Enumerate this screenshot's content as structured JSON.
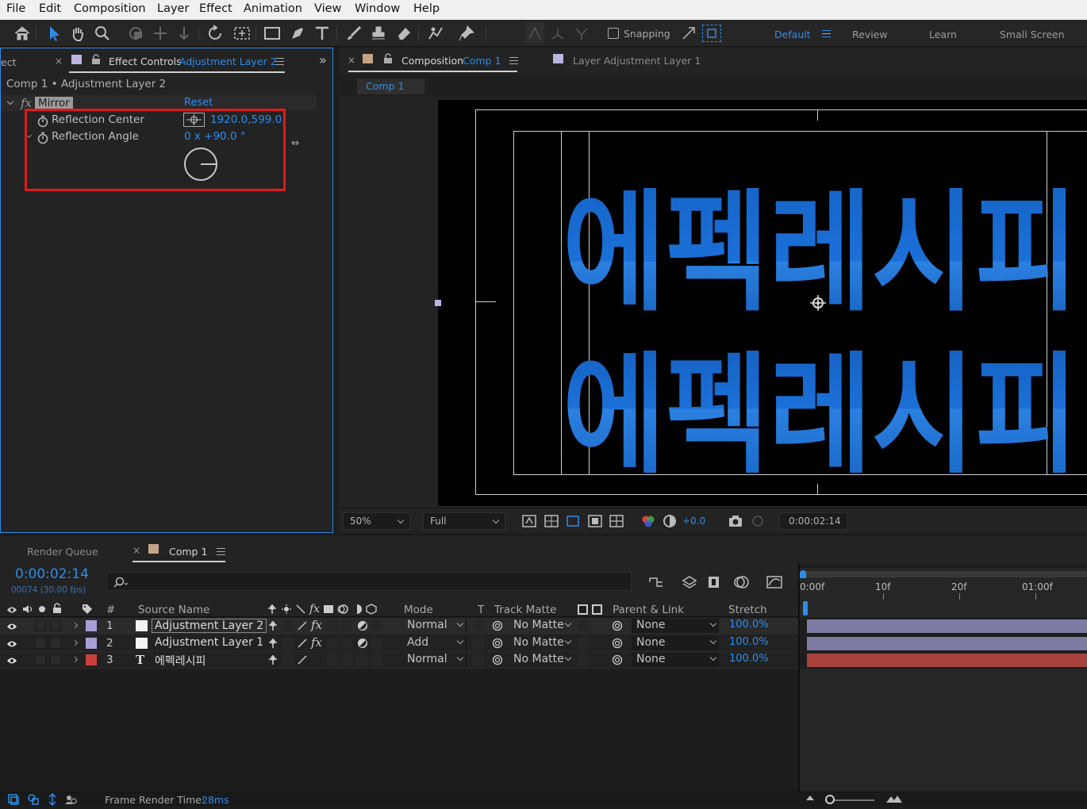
{
  "menu": [
    "File",
    "Edit",
    "Composition",
    "Layer",
    "Effect",
    "Animation",
    "View",
    "Window",
    "Help"
  ],
  "toolbar": {
    "tools": [
      "home-icon",
      "selection-tool-icon",
      "hand-tool-icon",
      "zoom-tool-icon",
      "orbit-camera-icon",
      "pan-camera-icon",
      "dolly-camera-icon",
      "rotate-tool-icon",
      "pan-behind-icon",
      "rectangle-tool-icon",
      "pen-tool-icon",
      "type-tool-icon",
      "brush-tool-icon",
      "clone-stamp-icon",
      "eraser-tool-icon",
      "roto-brush-icon",
      "puppet-pin-icon"
    ],
    "snapping_label": "Snapping",
    "workspaces": [
      "Default",
      "Review",
      "Learn",
      "Small Screen"
    ],
    "active_workspace": "Default"
  },
  "effect_controls": {
    "tab_prefix": "ect",
    "tab_title": "Effect Controls",
    "tab_layer": "Adjustment Layer 2",
    "breadcrumb": "Comp 1 • Adjustment Layer 2",
    "effect_fx": "fx",
    "effect_name": "Mirror",
    "reset_label": "Reset",
    "props": [
      {
        "name": "Reflection Center",
        "value": "1920.0,599.0"
      },
      {
        "name": "Reflection Angle",
        "value": "0 x +90.0 °"
      }
    ]
  },
  "composition": {
    "tab_title": "Composition",
    "tab_comp": "Comp 1",
    "layer_tab": "Layer Adjustment Layer 1",
    "flow_tab": "Comp 1",
    "viewer_text_top": "에펙레시피",
    "viewer_text_bottom": "에펙레시피",
    "zoom": "50%",
    "resolution": "Full",
    "exposure": "+0.0",
    "timecode": "0:00:02:14"
  },
  "timeline": {
    "render_queue": "Render Queue",
    "tab_comp": "Comp 1",
    "timecode": "0:00:02:14",
    "frames": "00074 (30.00 fps)",
    "search_icon": "search-icon",
    "columns": {
      "num": "#",
      "source": "Source Name",
      "mode": "Mode",
      "t": "T",
      "matte": "Track Matte",
      "parent": "Parent & Link",
      "stretch": "Stretch"
    },
    "ruler": [
      "0:00f",
      "10f",
      "20f",
      "01:00f"
    ],
    "layers": [
      {
        "num": "1",
        "type": "box",
        "name": "Adjustment Layer 2",
        "mode": "Normal",
        "matte": "No Matte",
        "parent": "None",
        "stretch": "100.0%",
        "color": "#a6a0d6",
        "bar": "#7d7aa4",
        "fx": "fx"
      },
      {
        "num": "2",
        "type": "box",
        "name": "Adjustment Layer 1",
        "mode": "Add",
        "matte": "No Matte",
        "parent": "None",
        "stretch": "100.0%",
        "color": "#a6a0d6",
        "bar": "#7d7aa4",
        "fx": "fx"
      },
      {
        "num": "3",
        "type": "T",
        "name": "에펙레시피",
        "mode": "Normal",
        "matte": "No Matte",
        "parent": "None",
        "stretch": "100.0%",
        "color": "#c9413a",
        "bar": "#a9423c",
        "fx": ""
      }
    ],
    "footer": {
      "label": "Frame Render Time:",
      "value": "28ms"
    }
  },
  "colors": {
    "accent": "#2d8ceb",
    "highlight": "#e01a1a",
    "text_fill": "#1f6fd8"
  }
}
